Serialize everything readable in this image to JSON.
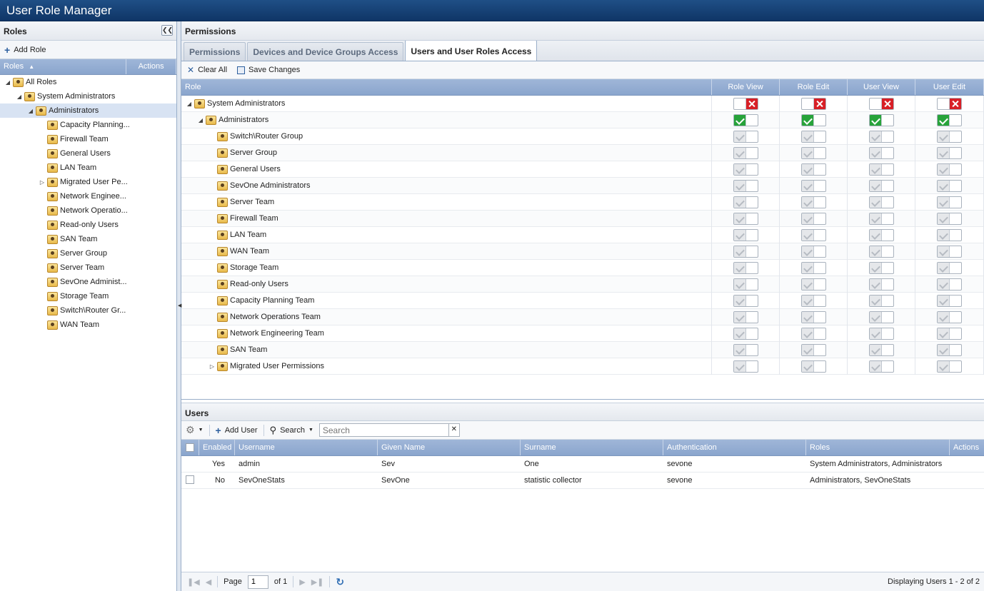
{
  "app": {
    "title": "User Role Manager"
  },
  "roles_panel": {
    "header": "Roles",
    "add_role_label": "Add Role",
    "columns": {
      "roles": "Roles",
      "actions": "Actions"
    },
    "tree": [
      {
        "label": "All Roles",
        "level": 0,
        "expanded": true
      },
      {
        "label": "System Administrators",
        "level": 1,
        "expanded": true
      },
      {
        "label": "Administrators",
        "level": 2,
        "expanded": true,
        "selected": true
      },
      {
        "label": "Capacity Planning...",
        "level": 3
      },
      {
        "label": "Firewall Team",
        "level": 3
      },
      {
        "label": "General Users",
        "level": 3
      },
      {
        "label": "LAN Team",
        "level": 3
      },
      {
        "label": "Migrated User Pe...",
        "level": 3,
        "collapsed": true
      },
      {
        "label": "Network Enginee...",
        "level": 3
      },
      {
        "label": "Network Operatio...",
        "level": 3
      },
      {
        "label": "Read-only Users",
        "level": 3
      },
      {
        "label": "SAN Team",
        "level": 3
      },
      {
        "label": "Server Group",
        "level": 3
      },
      {
        "label": "Server Team",
        "level": 3
      },
      {
        "label": "SevOne Administ...",
        "level": 3
      },
      {
        "label": "Storage Team",
        "level": 3
      },
      {
        "label": "Switch\\Router Gr...",
        "level": 3
      },
      {
        "label": "WAN Team",
        "level": 3
      }
    ]
  },
  "permissions": {
    "header": "Permissions",
    "tabs": [
      {
        "label": "Permissions",
        "active": false
      },
      {
        "label": "Devices and Device Groups Access",
        "active": false
      },
      {
        "label": "Users and User Roles Access",
        "active": true
      }
    ],
    "clear_all_label": "Clear All",
    "save_changes_label": "Save Changes",
    "columns": {
      "role": "Role",
      "role_view": "Role View",
      "role_edit": "Role Edit",
      "user_view": "User View",
      "user_edit": "User Edit"
    },
    "rows": [
      {
        "label": "System Administrators",
        "indent": 0,
        "expander": "open",
        "state": "denied"
      },
      {
        "label": "Administrators",
        "indent": 1,
        "expander": "open",
        "state": "granted"
      },
      {
        "label": "Switch\\Router Group",
        "indent": 2,
        "state": "inherited"
      },
      {
        "label": "Server Group",
        "indent": 2,
        "state": "inherited"
      },
      {
        "label": "General Users",
        "indent": 2,
        "state": "inherited"
      },
      {
        "label": "SevOne Administrators",
        "indent": 2,
        "state": "inherited"
      },
      {
        "label": "Server Team",
        "indent": 2,
        "state": "inherited"
      },
      {
        "label": "Firewall Team",
        "indent": 2,
        "state": "inherited"
      },
      {
        "label": "LAN Team",
        "indent": 2,
        "state": "inherited"
      },
      {
        "label": "WAN Team",
        "indent": 2,
        "state": "inherited"
      },
      {
        "label": "Storage Team",
        "indent": 2,
        "state": "inherited"
      },
      {
        "label": "Read-only Users",
        "indent": 2,
        "state": "inherited"
      },
      {
        "label": "Capacity Planning Team",
        "indent": 2,
        "state": "inherited"
      },
      {
        "label": "Network Operations Team",
        "indent": 2,
        "state": "inherited"
      },
      {
        "label": "Network Engineering Team",
        "indent": 2,
        "state": "inherited"
      },
      {
        "label": "SAN Team",
        "indent": 2,
        "state": "inherited"
      },
      {
        "label": "Migrated User Permissions",
        "indent": 2,
        "expander": "closed",
        "state": "inherited"
      }
    ]
  },
  "users": {
    "header": "Users",
    "add_user_label": "Add User",
    "search_label": "Search",
    "search_placeholder": "Search",
    "columns": {
      "enabled": "Enabled",
      "username": "Username",
      "given_name": "Given Name",
      "surname": "Surname",
      "authentication": "Authentication",
      "roles": "Roles",
      "actions": "Actions"
    },
    "rows": [
      {
        "enabled": "Yes",
        "username": "admin",
        "given_name": "Sev",
        "surname": "One",
        "authentication": "sevone",
        "roles": "System Administrators, Administrators",
        "checkbox": false
      },
      {
        "enabled": "No",
        "username": "SevOneStats",
        "given_name": "SevOne",
        "surname": "statistic collector",
        "authentication": "sevone",
        "roles": "Administrators, SevOneStats",
        "checkbox": true
      }
    ],
    "pager": {
      "page_label": "Page",
      "page_value": "1",
      "of_label": "of 1",
      "display_info": "Displaying Users 1 - 2 of 2"
    }
  }
}
